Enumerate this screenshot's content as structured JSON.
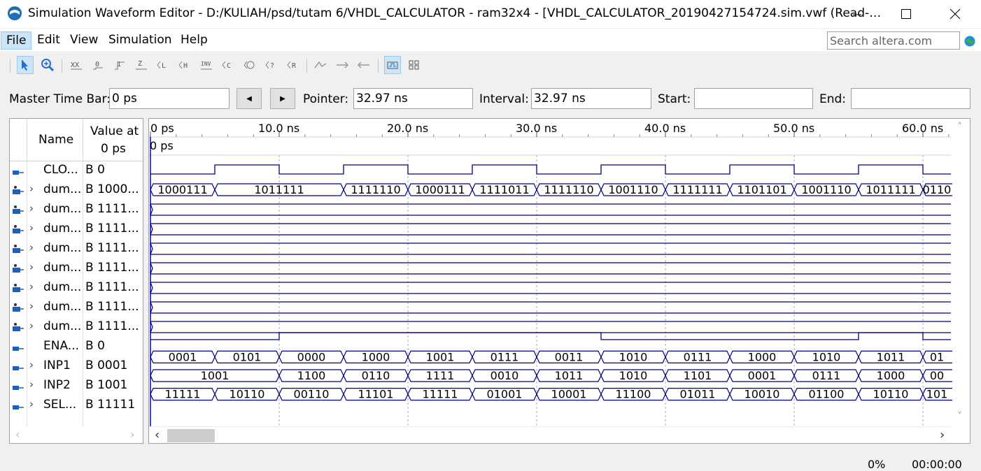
{
  "window": {
    "title": "Simulation Waveform Editor - D:/KULIAH/psd/tutam 6/VHDL_CALCULATOR - ram32x4 - [VHDL_CALCULATOR_20190427154724.sim.vwf (Read-…"
  },
  "menu": [
    "File",
    "Edit",
    "View",
    "Simulation",
    "Help"
  ],
  "search": {
    "placeholder": "Search altera.com"
  },
  "timebar": {
    "master_label": "Master Time Bar:",
    "master_value": "0 ps",
    "pointer_label": "Pointer:",
    "pointer_value": "32.97 ns",
    "interval_label": "Interval:",
    "interval_value": "32.97 ns",
    "start_label": "Start:",
    "start_value": "",
    "end_label": "End:",
    "end_value": ""
  },
  "columns": {
    "name": "Name",
    "value_line1": "Value at",
    "value_line2": "0 ps"
  },
  "ruler": {
    "ticks": [
      "0 ps",
      "10.0 ns",
      "20.0 ns",
      "30.0 ns",
      "40.0 ns",
      "50.0 ns",
      "60.0 ns"
    ],
    "cursor_label": "0 ps",
    "ns_per_division": 10
  },
  "signals": [
    {
      "dir": "in",
      "name": "CLO...",
      "value": "B 0",
      "expand": false
    },
    {
      "dir": "out",
      "name": "dum...",
      "value": "B 1000...",
      "expand": true
    },
    {
      "dir": "out",
      "name": "dum...",
      "value": "B 1111...",
      "expand": true
    },
    {
      "dir": "out",
      "name": "dum...",
      "value": "B 1111...",
      "expand": true
    },
    {
      "dir": "out",
      "name": "dum...",
      "value": "B 1111...",
      "expand": true
    },
    {
      "dir": "out",
      "name": "dum...",
      "value": "B 1111...",
      "expand": true
    },
    {
      "dir": "out",
      "name": "dum...",
      "value": "B 1111...",
      "expand": true
    },
    {
      "dir": "out",
      "name": "dum...",
      "value": "B 1111...",
      "expand": true
    },
    {
      "dir": "out",
      "name": "dum...",
      "value": "B 1111...",
      "expand": true
    },
    {
      "dir": "in",
      "name": "ENA...",
      "value": "B 0",
      "expand": false
    },
    {
      "dir": "in",
      "name": "INP1",
      "value": "B 0001",
      "expand": true
    },
    {
      "dir": "in",
      "name": "INP2",
      "value": "B 1001",
      "expand": true
    },
    {
      "dir": "in",
      "name": "SEL...",
      "value": "B 11111",
      "expand": true
    }
  ],
  "waves": {
    "clock": {
      "period_ns": 10,
      "first_high_ns": 5
    },
    "bus_row1": {
      "segments": [
        [
          0,
          "1000111"
        ],
        [
          5,
          "1011111"
        ],
        [
          15,
          "1111110"
        ],
        [
          20,
          "1000111"
        ],
        [
          25,
          "1111011"
        ],
        [
          30,
          "1111110"
        ],
        [
          35,
          "1001110"
        ],
        [
          40,
          "1111111"
        ],
        [
          45,
          "1101101"
        ],
        [
          50,
          "1001110"
        ],
        [
          55,
          "1011111"
        ],
        [
          60,
          "0110"
        ]
      ]
    },
    "enable": {
      "edges_ns": [
        10,
        35,
        55,
        60
      ],
      "initial": 0
    },
    "bus_inp_a": {
      "segments": [
        [
          0,
          "0001"
        ],
        [
          5,
          "0101"
        ],
        [
          10,
          "0000"
        ],
        [
          15,
          "1000"
        ],
        [
          20,
          "1001"
        ],
        [
          25,
          "0111"
        ],
        [
          30,
          "0011"
        ],
        [
          35,
          "1010"
        ],
        [
          40,
          "0111"
        ],
        [
          45,
          "1000"
        ],
        [
          50,
          "1010"
        ],
        [
          55,
          "1011"
        ],
        [
          60,
          "01"
        ]
      ]
    },
    "bus_inp_b": {
      "segments": [
        [
          0,
          "1001"
        ],
        [
          10,
          "1100"
        ],
        [
          15,
          "0110"
        ],
        [
          20,
          "1111"
        ],
        [
          25,
          "0010"
        ],
        [
          30,
          "1011"
        ],
        [
          35,
          "1010"
        ],
        [
          40,
          "1101"
        ],
        [
          45,
          "0001"
        ],
        [
          50,
          "0111"
        ],
        [
          55,
          "1000"
        ],
        [
          60,
          "00"
        ]
      ]
    },
    "bus_sel": {
      "segments": [
        [
          0,
          "11111"
        ],
        [
          5,
          "10110"
        ],
        [
          10,
          "00110"
        ],
        [
          15,
          "11101"
        ],
        [
          20,
          "11111"
        ],
        [
          25,
          "01001"
        ],
        [
          30,
          "10001"
        ],
        [
          35,
          "11100"
        ],
        [
          40,
          "01011"
        ],
        [
          45,
          "10010"
        ],
        [
          50,
          "01100"
        ],
        [
          55,
          "10110"
        ],
        [
          60,
          "101"
        ]
      ]
    }
  },
  "status": {
    "progress": "0%",
    "elapsed": "00:00:00"
  },
  "colors": {
    "wave": "#000080",
    "select": "#cce4f7",
    "cursor": "#0000c0"
  }
}
